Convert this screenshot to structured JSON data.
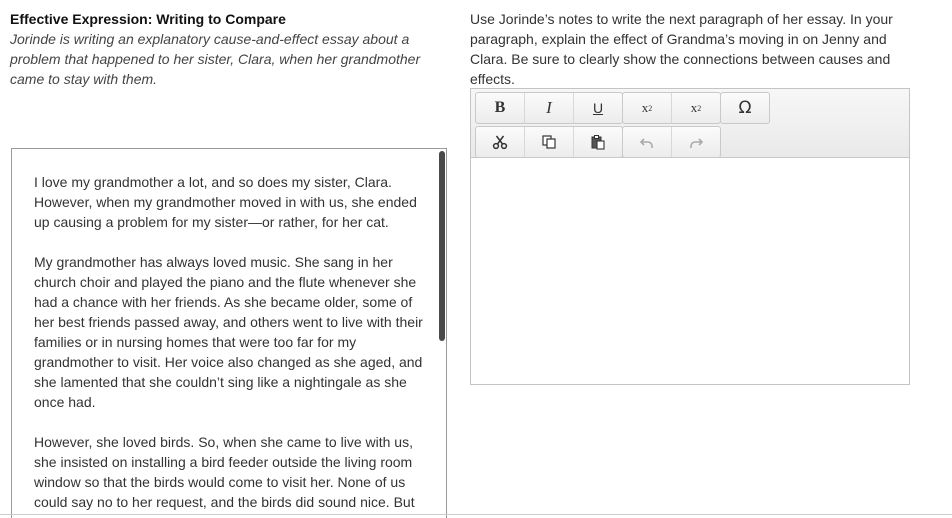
{
  "left": {
    "title": "Effective Expression: Writing to Compare",
    "intro": "Jorinde is writing an explanatory cause-and-effect essay about a problem that happened to her sister, Clara, when her grandmother came to stay with them."
  },
  "passage": {
    "paragraphs": [
      "I love my grandmother a lot, and so does my sister, Clara. However, when my grandmother moved in with us, she ended up causing a problem for my sister—or rather, for her cat.",
      "My grandmother has always loved music. She sang in her church choir and played the piano and the flute whenever she had a chance with her friends. As she became older, some of her best friends passed away, and others went to live with their families or in nursing homes that were too far for my grandmother to visit. Her voice also changed as she aged, and she lamented that she couldn’t sing like a nightingale as she once had.",
      "However, she loved birds. So, when she came to live with us, she insisted on installing a bird feeder outside the living room window so that the birds would come to visit her. None of us could say no to her request, and the birds did sound nice. But"
    ]
  },
  "prompt": {
    "text": "Use Jorinde’s notes to write the next paragraph of her essay. In your paragraph, explain the effect of Grandma’s moving in on Jenny and Clara. Be sure to clearly show the connections between causes and effects."
  },
  "toolbar": {
    "bold": "B",
    "italic": "I",
    "underline": "U",
    "superscript_base": "x",
    "superscript_mark": "2",
    "subscript_base": "x",
    "subscript_mark": "2",
    "special_char": "Ω"
  },
  "icons": {
    "cut": "scissors-icon",
    "copy": "copy-icon",
    "paste": "paste-icon",
    "undo": "undo-icon",
    "redo": "redo-icon"
  }
}
